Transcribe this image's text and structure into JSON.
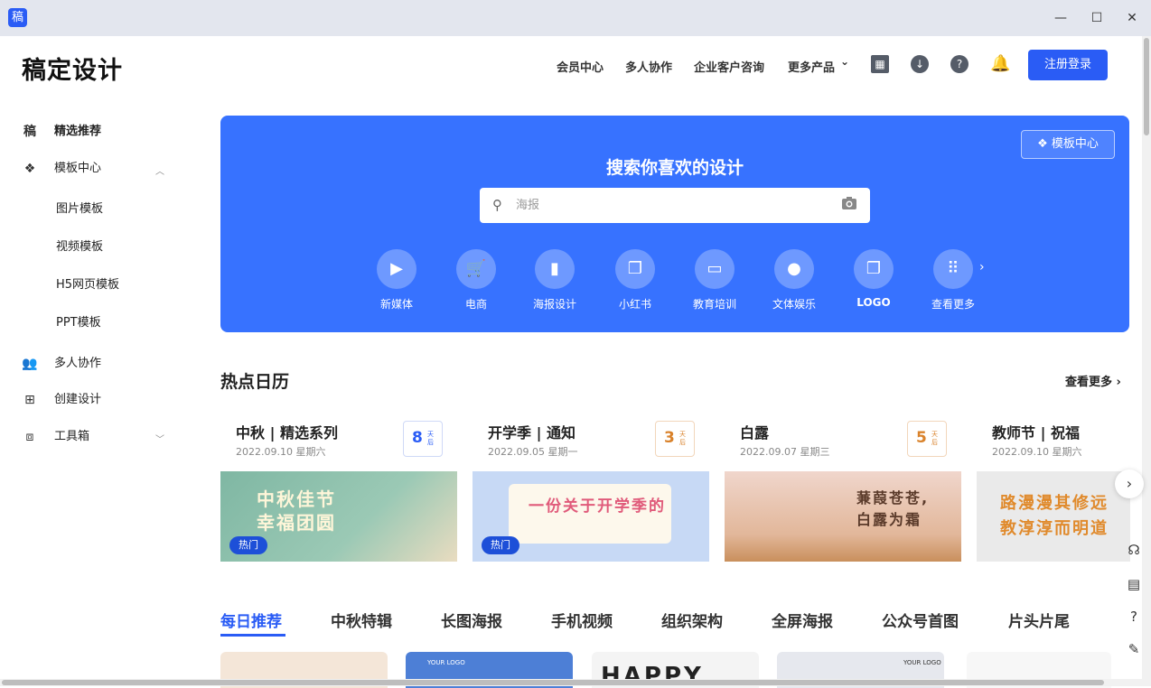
{
  "window": {
    "app_icon_text": "稿",
    "minimize": "—",
    "maximize": "☐",
    "close": "✕"
  },
  "header": {
    "logo": "稿定设计",
    "nav": [
      "会员中心",
      "多人协作",
      "企业客户咨询",
      "更多产品"
    ],
    "more_caret": "⌄",
    "login": "注册登录"
  },
  "sidebar": {
    "featured": {
      "icon": "稿",
      "label": "精选推荐"
    },
    "template_center": "模板中心",
    "sub_items": [
      "图片模板",
      "视频模板",
      "H5网页模板",
      "PPT模板"
    ],
    "collab": "多人协作",
    "create": "创建设计",
    "toolbox": "工具箱"
  },
  "hero": {
    "title": "搜索你喜欢的设计",
    "template_center_btn": "模板中心",
    "search_placeholder": "海报",
    "categories": [
      {
        "label": "新媒体",
        "icon": "▶"
      },
      {
        "label": "电商",
        "icon": "🛒"
      },
      {
        "label": "海报设计",
        "icon": "▮"
      },
      {
        "label": "小红书",
        "icon": "❐"
      },
      {
        "label": "教育培训",
        "icon": "▭"
      },
      {
        "label": "文体娱乐",
        "icon": "●"
      },
      {
        "label": "LOGO",
        "icon": "❐"
      },
      {
        "label": "查看更多",
        "icon": "⠿"
      }
    ],
    "more_arrow": "›"
  },
  "calendar": {
    "title": "热点日历",
    "see_more": "查看更多 ›",
    "items": [
      {
        "title": "中秋 | 精选系列",
        "date": "2022.09.10  星期六",
        "days": "8",
        "unit": "天后",
        "color": "#2a5cf5",
        "hot": "热门",
        "img_text": "中秋佳节\n幸福团圆",
        "bg": "#7fb7a3",
        "fg": "#fff6d9"
      },
      {
        "title": "开学季 | 通知",
        "date": "2022.09.05  星期一",
        "days": "3",
        "unit": "天后",
        "color": "#d9822b",
        "hot": "热门",
        "img_text": "一份关于开学季的",
        "bg": "#c7d9f5",
        "fg": "#e05a7a"
      },
      {
        "title": "白露",
        "date": "2022.09.07  星期三",
        "days": "5",
        "unit": "天后",
        "color": "#d9822b",
        "hot": "",
        "img_text": "蒹葭苍苍,\n白露为霜",
        "bg": "#e8c4b8",
        "fg": "#5a3a2a"
      },
      {
        "title": "教师节 | 祝福",
        "date": "2022.09.10  星期六",
        "days": "",
        "unit": "",
        "color": "#2a5cf5",
        "hot": "",
        "img_text": "路漫漫其修远\n教淳淳而明道",
        "bg": "#eaeaea",
        "fg": "#e08a2c"
      }
    ]
  },
  "tabs": [
    "每日推荐",
    "中秋特辑",
    "长图海报",
    "手机视频",
    "组织架构",
    "全屏海报",
    "公众号首图",
    "片头片尾"
  ],
  "float_tools": [
    "☊",
    "▤",
    "?",
    "✎"
  ],
  "thumbs": [
    {
      "bg": "#f4e6d8",
      "text": ""
    },
    {
      "bg": "#4d7fd6",
      "text": "YOUR LOGO"
    },
    {
      "bg": "#f4f4f4",
      "text": "HAPPY"
    },
    {
      "bg": "#e6e8ee",
      "text": "YOUR LOGO"
    },
    {
      "bg": "#f7f7f7",
      "text": ""
    }
  ]
}
